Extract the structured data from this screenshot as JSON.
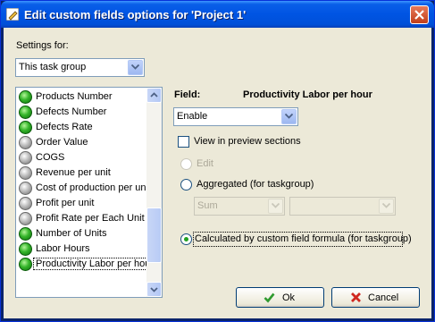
{
  "window": {
    "title": "Edit custom fields options for  'Project 1'"
  },
  "settings": {
    "label": "Settings for:",
    "scope_value": "This task group"
  },
  "fields_list": [
    {
      "label": "Products Number",
      "status": "green"
    },
    {
      "label": "Defects Number",
      "status": "green"
    },
    {
      "label": "Defects Rate",
      "status": "green"
    },
    {
      "label": "Order Value",
      "status": "gray"
    },
    {
      "label": "COGS",
      "status": "gray"
    },
    {
      "label": "Revenue per unit",
      "status": "gray"
    },
    {
      "label": "Cost of production per unit",
      "status": "gray"
    },
    {
      "label": "Profit per unit",
      "status": "gray"
    },
    {
      "label": "Profit Rate per Each Unit S",
      "status": "gray"
    },
    {
      "label": "Number of Units",
      "status": "green"
    },
    {
      "label": "Labor Hours",
      "status": "green"
    },
    {
      "label": "Productivity Labor per hou",
      "status": "green",
      "selected": true
    }
  ],
  "field_panel": {
    "field_label": "Field:",
    "field_name": "Productivity Labor per hour",
    "mode_value": "Enable",
    "view_in_preview_label": "View in preview sections",
    "edit_label": "Edit",
    "aggregated_label": "Aggregated (for taskgroup)",
    "aggregate_func_value": "Sum",
    "aggregate_field_value": "",
    "calculated_label": "Calculated by custom field formula (for taskgroup)"
  },
  "buttons": {
    "ok_label": "Ok",
    "cancel_label": "Cancel"
  },
  "colors": {
    "title_bar": "#0054e3",
    "dialog_bg": "#ece9d8",
    "ok_check": "#2f9a2f",
    "cancel_x": "#d0281f"
  }
}
